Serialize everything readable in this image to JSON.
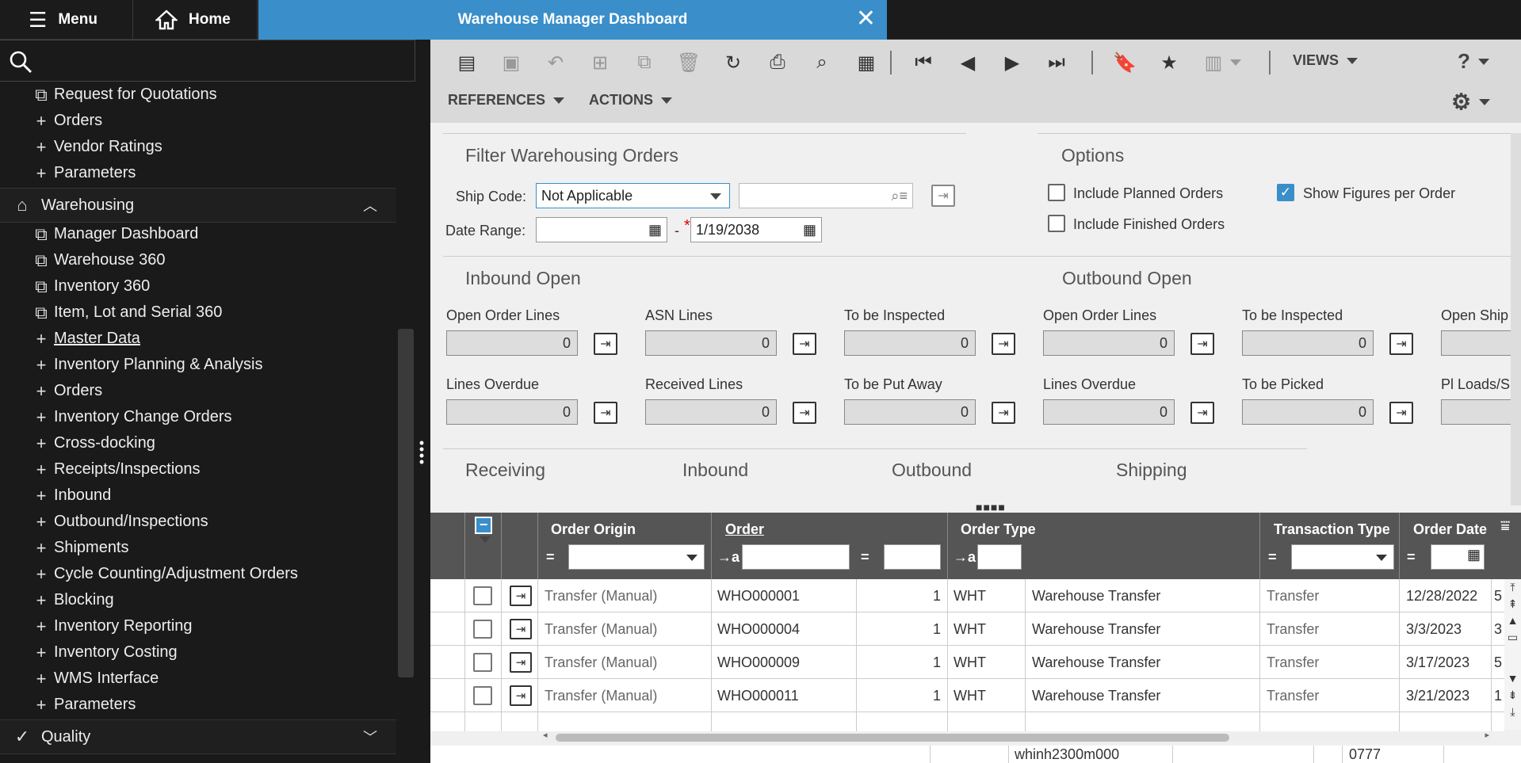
{
  "topbar": {
    "menu_label": "Menu",
    "home_label": "Home",
    "tab_title": "Warehouse Manager Dashboard",
    "close_glyph": "✕"
  },
  "sidebar": {
    "search_icon": "search-icon",
    "items": [
      {
        "icon": "⧉",
        "label": "Request for Quotations"
      },
      {
        "icon": "+",
        "label": "Orders"
      },
      {
        "icon": "+",
        "label": "Vendor Ratings"
      },
      {
        "icon": "+",
        "label": "Parameters"
      },
      {
        "icon": "⌂",
        "label": "Warehousing",
        "section": true,
        "chev": "︿"
      },
      {
        "icon": "⧉",
        "label": "Manager Dashboard"
      },
      {
        "icon": "⧉",
        "label": "Warehouse 360"
      },
      {
        "icon": "⧉",
        "label": "Inventory 360"
      },
      {
        "icon": "⧉",
        "label": "Item, Lot and Serial 360"
      },
      {
        "icon": "+",
        "label": "Master Data",
        "active": true
      },
      {
        "icon": "+",
        "label": "Inventory Planning & Analysis"
      },
      {
        "icon": "+",
        "label": "Orders"
      },
      {
        "icon": "+",
        "label": "Inventory Change Orders"
      },
      {
        "icon": "+",
        "label": "Cross-docking"
      },
      {
        "icon": "+",
        "label": "Receipts/Inspections"
      },
      {
        "icon": "+",
        "label": "Inbound"
      },
      {
        "icon": "+",
        "label": "Outbound/Inspections"
      },
      {
        "icon": "+",
        "label": "Shipments"
      },
      {
        "icon": "+",
        "label": "Cycle Counting/Adjustment Orders"
      },
      {
        "icon": "+",
        "label": "Blocking"
      },
      {
        "icon": "+",
        "label": "Inventory Reporting"
      },
      {
        "icon": "+",
        "label": "Inventory Costing"
      },
      {
        "icon": "+",
        "label": "WMS Interface"
      },
      {
        "icon": "+",
        "label": "Parameters"
      },
      {
        "icon": "✓",
        "label": "Quality",
        "section": true,
        "chev": "﹀"
      }
    ]
  },
  "toolbar": {
    "views_label": "VIEWS",
    "help_label": "?",
    "references_label": "REFERENCES",
    "actions_label": "ACTIONS"
  },
  "filter": {
    "title": "Filter Warehousing Orders",
    "ship_code_label": "Ship Code:",
    "ship_code_value": "Not Applicable",
    "date_range_label": "Date Range:",
    "date_sep": "-",
    "required_mark": "*",
    "date_to": "1/19/2038"
  },
  "options": {
    "title": "Options",
    "include_planned": "Include Planned Orders",
    "include_planned_checked": false,
    "include_finished": "Include Finished Orders",
    "include_finished_checked": false,
    "show_figures": "Show Figures per Order",
    "show_figures_checked": true
  },
  "inbound": {
    "title": "Inbound Open",
    "fields": [
      {
        "label": "Open Order Lines",
        "value": "0"
      },
      {
        "label": "ASN Lines",
        "value": "0"
      },
      {
        "label": "To be Inspected",
        "value": "0"
      },
      {
        "label": "Lines Overdue",
        "value": "0"
      },
      {
        "label": "Received Lines",
        "value": "0"
      },
      {
        "label": "To be Put Away",
        "value": "0"
      }
    ]
  },
  "outbound": {
    "title": "Outbound Open",
    "fields": [
      {
        "label": "Open Order Lines",
        "value": "0"
      },
      {
        "label": "To be Inspected",
        "value": "0"
      },
      {
        "label": "Open Ship",
        "value": ""
      },
      {
        "label": "Lines Overdue",
        "value": "0"
      },
      {
        "label": "To be Picked",
        "value": "0"
      },
      {
        "label": "Pl Loads/S",
        "value": ""
      }
    ]
  },
  "sections": {
    "receiving": "Receiving",
    "inbound": "Inbound",
    "outbound": "Outbound",
    "shipping": "Shipping"
  },
  "grid": {
    "headers": {
      "order_origin": "Order Origin",
      "order": "Order",
      "order_type": "Order Type",
      "transaction_type": "Transaction Type",
      "order_date": "Order Date"
    },
    "filter_ops": {
      "eq": "=",
      "begins": "→a"
    },
    "rows": [
      {
        "origin": "Transfer (Manual)",
        "order": "WHO000001",
        "seq": "1",
        "type": "WHT",
        "type_desc": "Warehouse Transfer",
        "trans": "Transfer",
        "date": "12/28/2022",
        "extra": "5"
      },
      {
        "origin": "Transfer (Manual)",
        "order": "WHO000004",
        "seq": "1",
        "type": "WHT",
        "type_desc": "Warehouse Transfer",
        "trans": "Transfer",
        "date": "3/3/2023",
        "extra": "3"
      },
      {
        "origin": "Transfer (Manual)",
        "order": "WHO000009",
        "seq": "1",
        "type": "WHT",
        "type_desc": "Warehouse Transfer",
        "trans": "Transfer",
        "date": "3/17/2023",
        "extra": "5"
      },
      {
        "origin": "Transfer (Manual)",
        "order": "WHO000011",
        "seq": "1",
        "type": "WHT",
        "type_desc": "Warehouse Transfer",
        "trans": "Transfer",
        "date": "3/21/2023",
        "extra": "1"
      }
    ]
  },
  "status": {
    "session": "whinh2300m000",
    "company": "0777"
  },
  "colors": {
    "accent": "#3a8ec9",
    "sidebar_bg": "#1a1a1a",
    "toolbar_bg": "#d9d9d9",
    "grid_header_bg": "#555555"
  }
}
